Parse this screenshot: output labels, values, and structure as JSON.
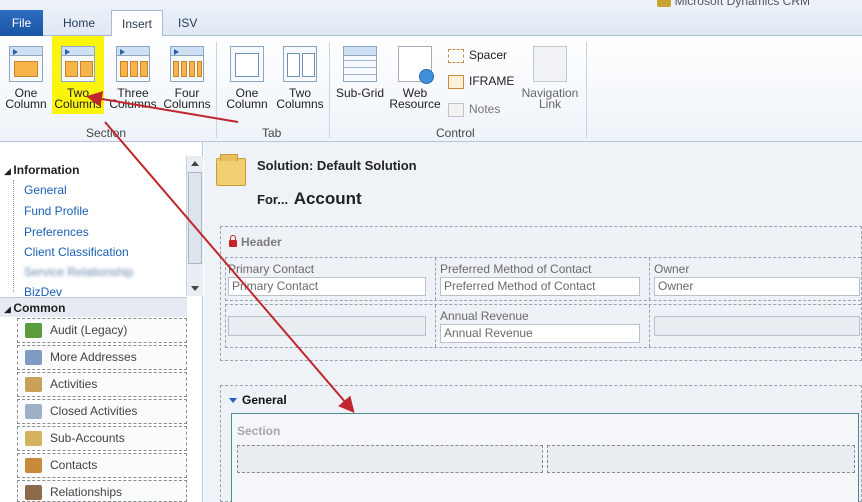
{
  "brand": "Microsoft Dynamics CRM",
  "tabs": [
    {
      "label": "File"
    },
    {
      "label": "Home"
    },
    {
      "label": "Insert"
    },
    {
      "label": "ISV"
    }
  ],
  "ribbon": {
    "section_group": {
      "label": "Section",
      "buttons": [
        {
          "line1": "One",
          "line2": "Column"
        },
        {
          "line1": "Two",
          "line2": "Columns"
        },
        {
          "line1": "Three",
          "line2": "Columns"
        },
        {
          "line1": "Four",
          "line2": "Columns"
        }
      ]
    },
    "tab_group": {
      "label": "Tab",
      "buttons": [
        {
          "line1": "One",
          "line2": "Column"
        },
        {
          "line1": "Two",
          "line2": "Columns"
        }
      ]
    },
    "control_group": {
      "label": "Control",
      "subgrid": {
        "line1": "Sub-Grid"
      },
      "web_resource": {
        "line1": "Web",
        "line2": "Resource"
      },
      "spacer": "Spacer",
      "iframe": "IFRAME",
      "notes": "Notes",
      "navigation_link": {
        "line1": "Navigation",
        "line2": "Link"
      }
    }
  },
  "nav": {
    "information": "Information",
    "links": [
      "General",
      "Fund Profile",
      "Preferences",
      "Client Classification",
      "Service Relationship",
      "BizDev"
    ],
    "common": "Common",
    "common_items": [
      {
        "label": "Audit (Legacy)",
        "icon": "audit-icon",
        "color": "#5a9c3a"
      },
      {
        "label": "More Addresses",
        "icon": "addresses-icon",
        "color": "#7f9bc4"
      },
      {
        "label": "Activities",
        "icon": "activities-icon",
        "color": "#c9a25a"
      },
      {
        "label": "Closed Activities",
        "icon": "closed-activities-icon",
        "color": "#9fb0c6"
      },
      {
        "label": "Sub-Accounts",
        "icon": "sub-accounts-icon",
        "color": "#d4b260"
      },
      {
        "label": "Contacts",
        "icon": "contacts-icon",
        "color": "#c98a3a"
      },
      {
        "label": "Relationships",
        "icon": "relationships-icon",
        "color": "#8d6a4a"
      }
    ]
  },
  "main": {
    "solution_title": "Solution: Default Solution",
    "for_prefix": "For...",
    "entity": "Account",
    "header": {
      "label": "Header",
      "fields": {
        "primary_contact_label": "Primary Contact",
        "primary_contact_value": "Primary Contact",
        "preferred_method_label": "Preferred Method of Contact",
        "preferred_method_value": "Preferred Method of Contact",
        "owner_label": "Owner",
        "owner_value": "Owner",
        "annual_revenue_label": "Annual Revenue",
        "annual_revenue_value": "Annual Revenue"
      }
    },
    "general": {
      "label": "General",
      "section_label": "Section"
    }
  },
  "colors": {
    "highlight": "#fbf40f",
    "arrow": "#c0262d",
    "link": "#1a5fb4",
    "file_tab": "#1b53a2"
  }
}
